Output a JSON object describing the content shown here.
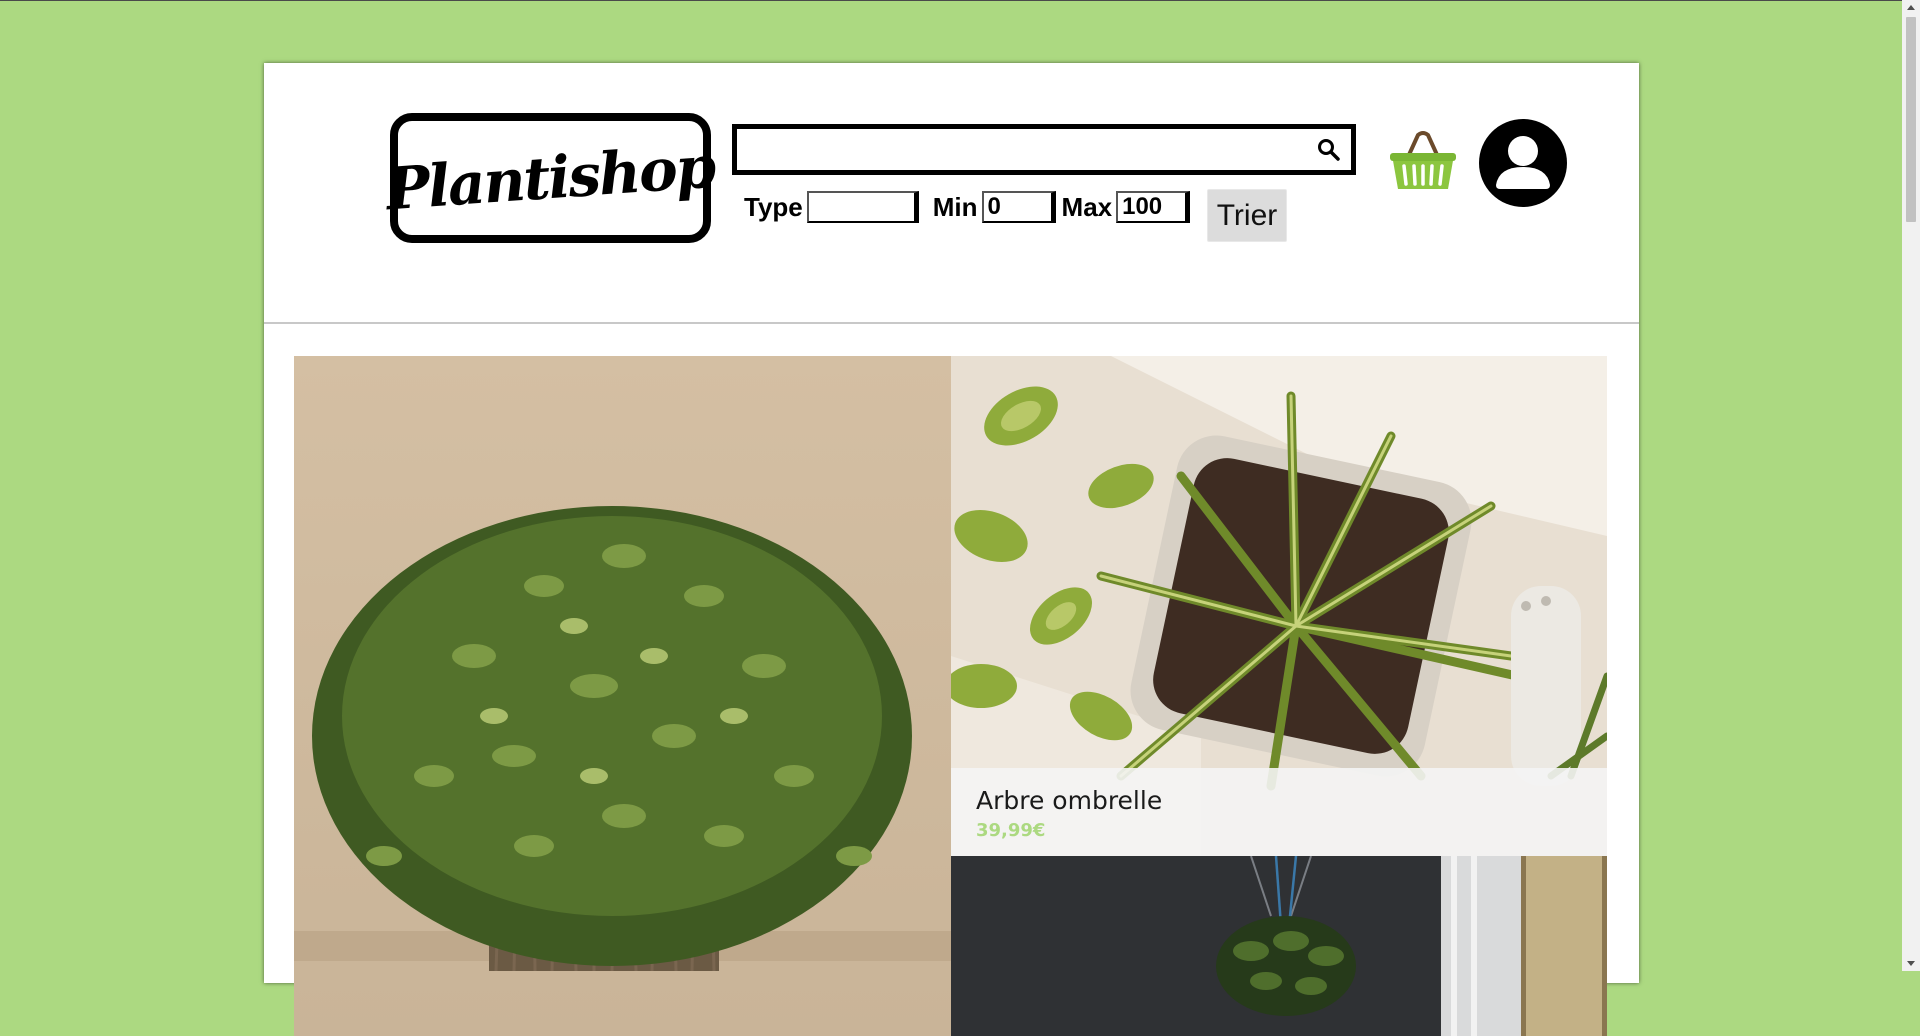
{
  "brand": {
    "logo_text": "Plantishop"
  },
  "search": {
    "value": "",
    "placeholder": ""
  },
  "filters": {
    "type_label": "Type",
    "type_value": "",
    "min_label": "Min",
    "min_value": "0",
    "max_label": "Max",
    "max_value": "100",
    "sort_button": "Trier"
  },
  "header_icons": {
    "cart": "basket-icon",
    "account": "user-icon"
  },
  "products": [
    {
      "image": "bushy-boxwood-plant-photo",
      "name": "",
      "price": ""
    },
    {
      "image": "spider-plant-pothos-photo",
      "name": "Arbre ombrelle",
      "price": "39,99€"
    },
    {
      "image": "hanging-plant-window-photo",
      "name": "",
      "price": ""
    }
  ],
  "colors": {
    "background": "#acd981",
    "accent": "#acd981",
    "basket": "#8cc63f",
    "panel": "#ffffff"
  }
}
